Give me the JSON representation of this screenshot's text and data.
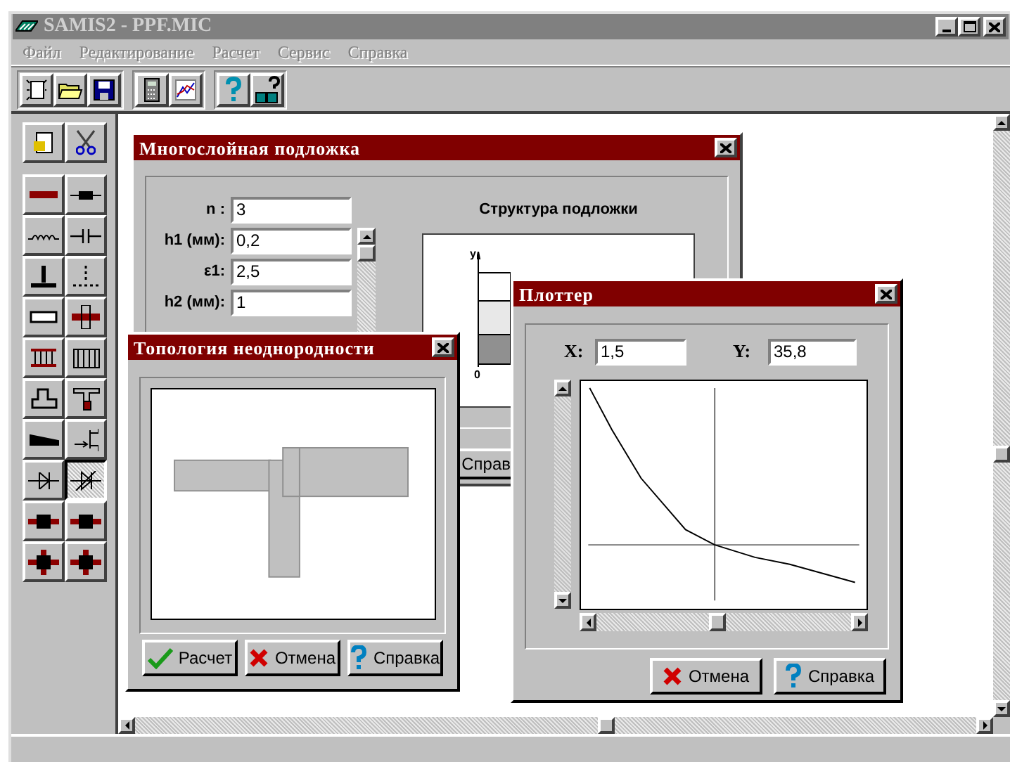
{
  "window": {
    "title": "SAMIS2 - PPF.MIC",
    "active": false
  },
  "menu": [
    {
      "label": "Файл",
      "disabled": true
    },
    {
      "label": "Редактирование",
      "disabled": true
    },
    {
      "label": "Расчет",
      "disabled": true
    },
    {
      "label": "Сервис",
      "disabled": true
    },
    {
      "label": "Справка",
      "disabled": true
    }
  ],
  "toolbox": [
    {
      "selected": false
    },
    {
      "selected": false
    },
    {
      "selected": false
    },
    {
      "selected": false
    },
    {
      "selected": false
    },
    {
      "selected": false
    },
    {
      "selected": false
    },
    {
      "selected": false
    },
    {
      "selected": false
    },
    {
      "selected": false
    },
    {
      "selected": false
    },
    {
      "selected": false
    },
    {
      "selected": false
    },
    {
      "selected": false
    },
    {
      "selected": false
    },
    {
      "selected": false
    },
    {
      "selected": false
    },
    {
      "selected": true
    },
    {
      "selected": false
    },
    {
      "selected": false
    },
    {
      "selected": false
    },
    {
      "selected": false
    }
  ],
  "layers_dialog": {
    "title": "Многослойная подложка",
    "fields": [
      {
        "label": "n :",
        "value": "3"
      },
      {
        "label": "h1 (мм):",
        "value": "0,2"
      },
      {
        "label": "ε1:",
        "value": "2,5"
      },
      {
        "label": "h2 (мм):",
        "value": "1"
      }
    ],
    "structure_title": "Структура подложки",
    "axis_y": "y",
    "axis_origin": "0",
    "help_button": "Справ"
  },
  "topology_dialog": {
    "title": "Топология неоднородности",
    "buttons": [
      {
        "label": "Расчет",
        "kind": "ok"
      },
      {
        "label": "Отмена",
        "kind": "cancel"
      },
      {
        "label": "Справка",
        "kind": "help"
      }
    ]
  },
  "plotter_dialog": {
    "title": "Плоттер",
    "x_label": "X:",
    "x_value": "1,5",
    "y_label": "Y:",
    "y_value": "35,8",
    "buttons": [
      {
        "label": "Отмена",
        "kind": "cancel"
      },
      {
        "label": "Справка",
        "kind": "help"
      }
    ]
  }
}
